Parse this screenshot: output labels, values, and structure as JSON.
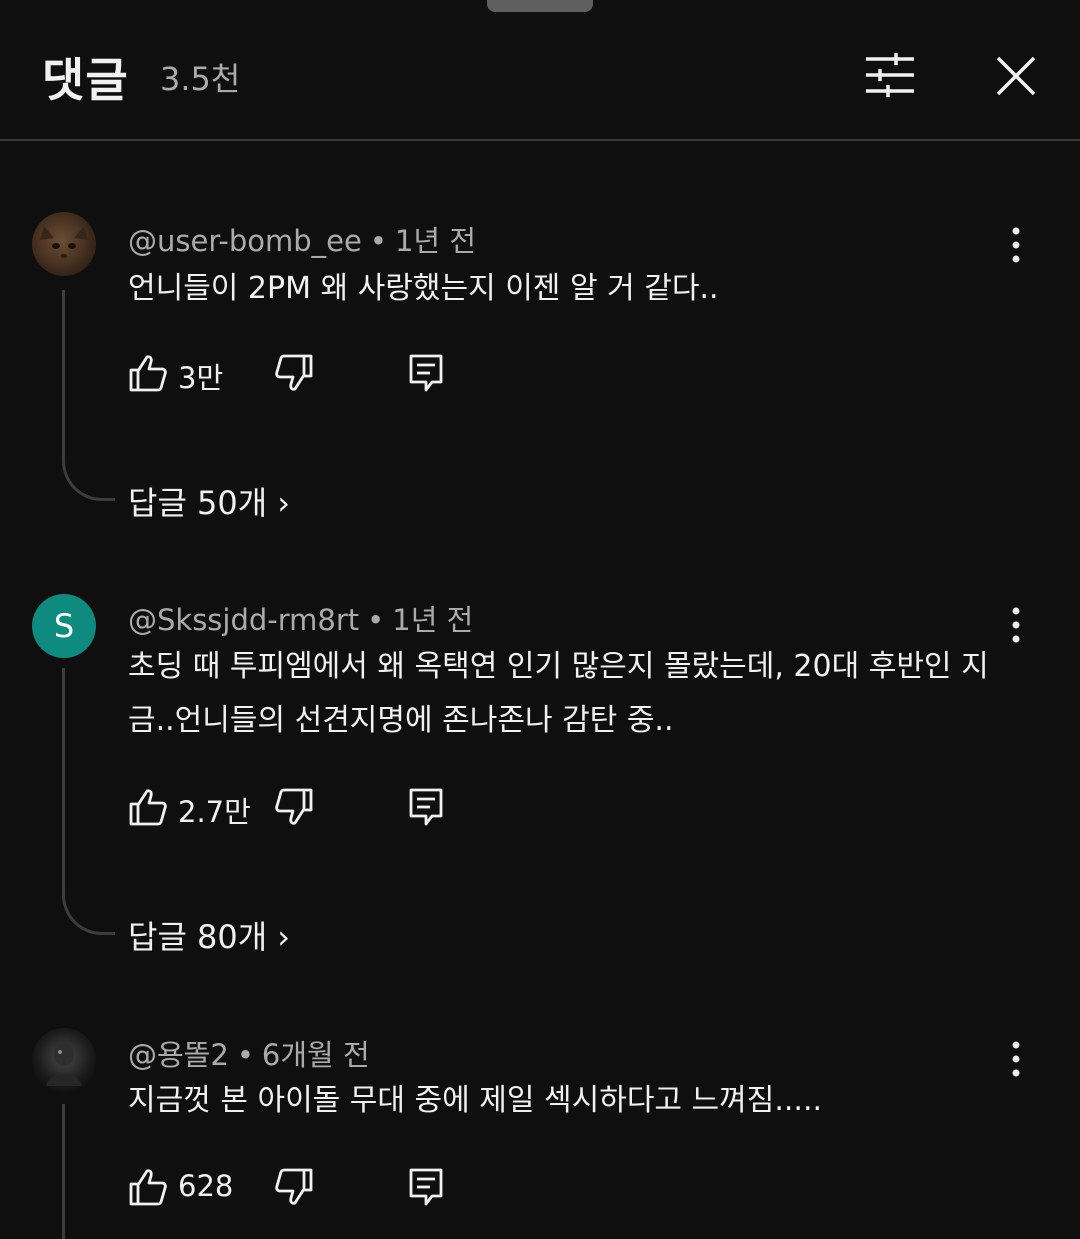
{
  "header": {
    "title": "댓글",
    "count": "3.5천",
    "filter_icon": "sliders-icon",
    "close_icon": "close-icon"
  },
  "comments": [
    {
      "author": "@user-bomb_ee",
      "time": "1년 전",
      "text": "언니들이 2PM 왜 사랑했는지 이젠 알 거 같다..",
      "likes": "3만",
      "replies": "답글 50개",
      "avatar": "cat-photo"
    },
    {
      "author": "@Skssjdd-rm8rt",
      "time": "1년 전",
      "text": "초딩 때 투피엠에서 왜 옥택연 인기 많은지 몰랐는데, 20대 후반인 지금..언니들의 선견지명에 존나존나 감탄 중..",
      "likes": "2.7만",
      "replies": "답글 80개",
      "avatar_letter": "S",
      "avatar_color": "#0f8a7e"
    },
    {
      "author": "@용똘2",
      "time": "6개월 전",
      "text": "지금껏 본 아이돌 무대 중에 제일 섹시하다고 느껴짐.....",
      "likes": "628",
      "avatar": "dark-photo"
    }
  ],
  "separator": "•",
  "chevron": "›",
  "colors": {
    "background": "#0f0f0f",
    "text": "#f1f1f1",
    "secondary": "#aaaaaa",
    "avatar_s": "#0f8a7e"
  }
}
